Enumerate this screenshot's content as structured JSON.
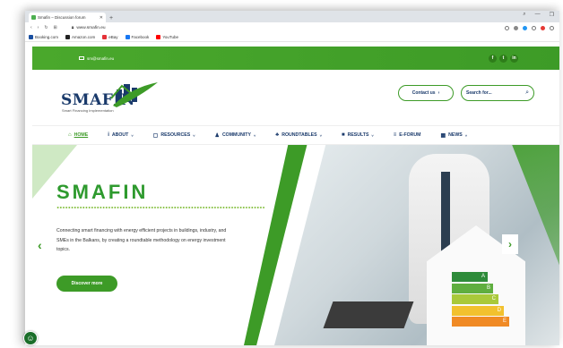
{
  "browser": {
    "tab_title": "Smafin – Discussion forum",
    "tab_close": "✕",
    "new_tab": "+",
    "url": "www.smafin.eu",
    "window_controls": [
      "⌕",
      "—",
      "❐"
    ],
    "bookmarks": [
      {
        "label": "Booking.com",
        "color": "#1a4fa0"
      },
      {
        "label": "Amazon.com",
        "color": "#222222"
      },
      {
        "label": "eBay",
        "color": "#e53238"
      },
      {
        "label": "Facebook",
        "color": "#1877f2"
      },
      {
        "label": "YouTube",
        "color": "#ff0000"
      }
    ]
  },
  "topbar": {
    "email": "sm@smafin.eu",
    "socials": [
      "f",
      "t",
      "in"
    ]
  },
  "header": {
    "logo_word": "SMAFIN",
    "logo_tagline": "Smart Financing Implementation",
    "contact_label": "Contact us",
    "search_placeholder": "Search for..."
  },
  "nav": {
    "items": [
      {
        "label": "HOME",
        "icon": "⌂",
        "active": true,
        "dropdown": false
      },
      {
        "label": "ABOUT",
        "icon": "i",
        "active": false,
        "dropdown": true
      },
      {
        "label": "RESOURCES",
        "icon": "▢",
        "active": false,
        "dropdown": true
      },
      {
        "label": "COMMUNITY",
        "icon": "♟",
        "active": false,
        "dropdown": true
      },
      {
        "label": "ROUNDTABLES",
        "icon": "♣",
        "active": false,
        "dropdown": true
      },
      {
        "label": "RESULTS",
        "icon": "■",
        "active": false,
        "dropdown": true
      },
      {
        "label": "E-FORUM",
        "icon": "≡",
        "active": false,
        "dropdown": false
      },
      {
        "label": "NEWS",
        "icon": "▦",
        "active": false,
        "dropdown": true
      }
    ]
  },
  "hero": {
    "title": "SMAFIN",
    "text": "Connecting smart financing with energy efficient projects in buildings, industry, and SMEs in the Balkans, by creating a roundtable methodology on energy investment topics.",
    "cta": "Discover more",
    "prev": "‹",
    "next": "›",
    "energy_labels": [
      "A",
      "B",
      "C",
      "D",
      "E"
    ]
  },
  "colors": {
    "brand_green": "#3d9b27",
    "brand_navy": "#1a3a6b"
  }
}
